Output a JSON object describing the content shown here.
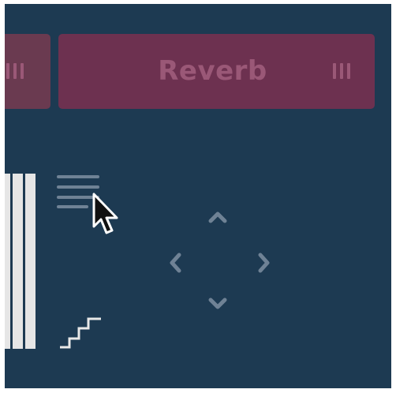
{
  "effects_bar": {
    "left_slot": {
      "grip_icon": "drag-grip-icon"
    },
    "reverb_slot": {
      "label": "Reverb",
      "grip_icon": "drag-grip-icon"
    }
  },
  "tools": {
    "menu_icon": "hamburger-menu-icon",
    "step_icon": "step-sequence-icon"
  },
  "nav_pad": {
    "up": "chevron-up-icon",
    "left": "chevron-left-icon",
    "right": "chevron-right-icon",
    "down": "chevron-down-icon"
  },
  "colors": {
    "background": "#1d3a52",
    "effect_slot": "#6d3150",
    "effect_label": "#9a5877",
    "icon": "#6f8295",
    "keys": "#e6e6e6"
  }
}
